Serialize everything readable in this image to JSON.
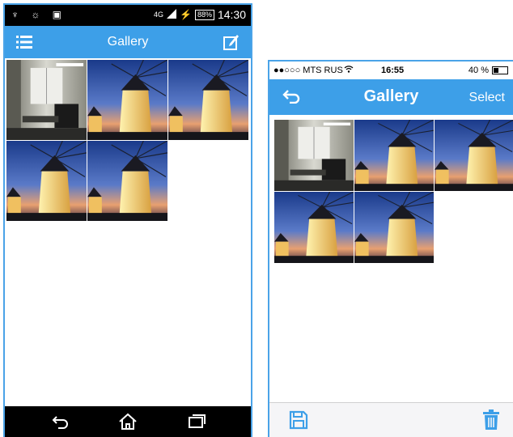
{
  "android": {
    "status": {
      "left_icons": "♆ ☼ ▣",
      "network": "4G",
      "battery": "88%",
      "time": "14:30"
    },
    "appbar": {
      "title": "Gallery"
    },
    "thumbnails": [
      "office-photo",
      "windmill-photo",
      "windmill-photo",
      "windmill-photo",
      "windmill-photo"
    ]
  },
  "ios": {
    "status": {
      "carrier": "●●○○○ MTS RUS",
      "time": "16:55",
      "battery": "40 %"
    },
    "navbar": {
      "title": "Gallery",
      "select_label": "Select"
    },
    "thumbnails": [
      "office-photo",
      "windmill-photo",
      "windmill-photo",
      "windmill-photo",
      "windmill-photo"
    ]
  },
  "colors": {
    "accent": "#3d9fe8",
    "frame": "#4aa3e8"
  },
  "icons": {
    "android_menu": "list-menu-icon",
    "android_edit": "edit-icon",
    "android_back": "back-icon",
    "android_home": "home-icon",
    "android_recents": "recents-icon",
    "ios_back": "back-arrow-icon",
    "ios_save": "save-icon",
    "ios_delete": "trash-icon"
  }
}
